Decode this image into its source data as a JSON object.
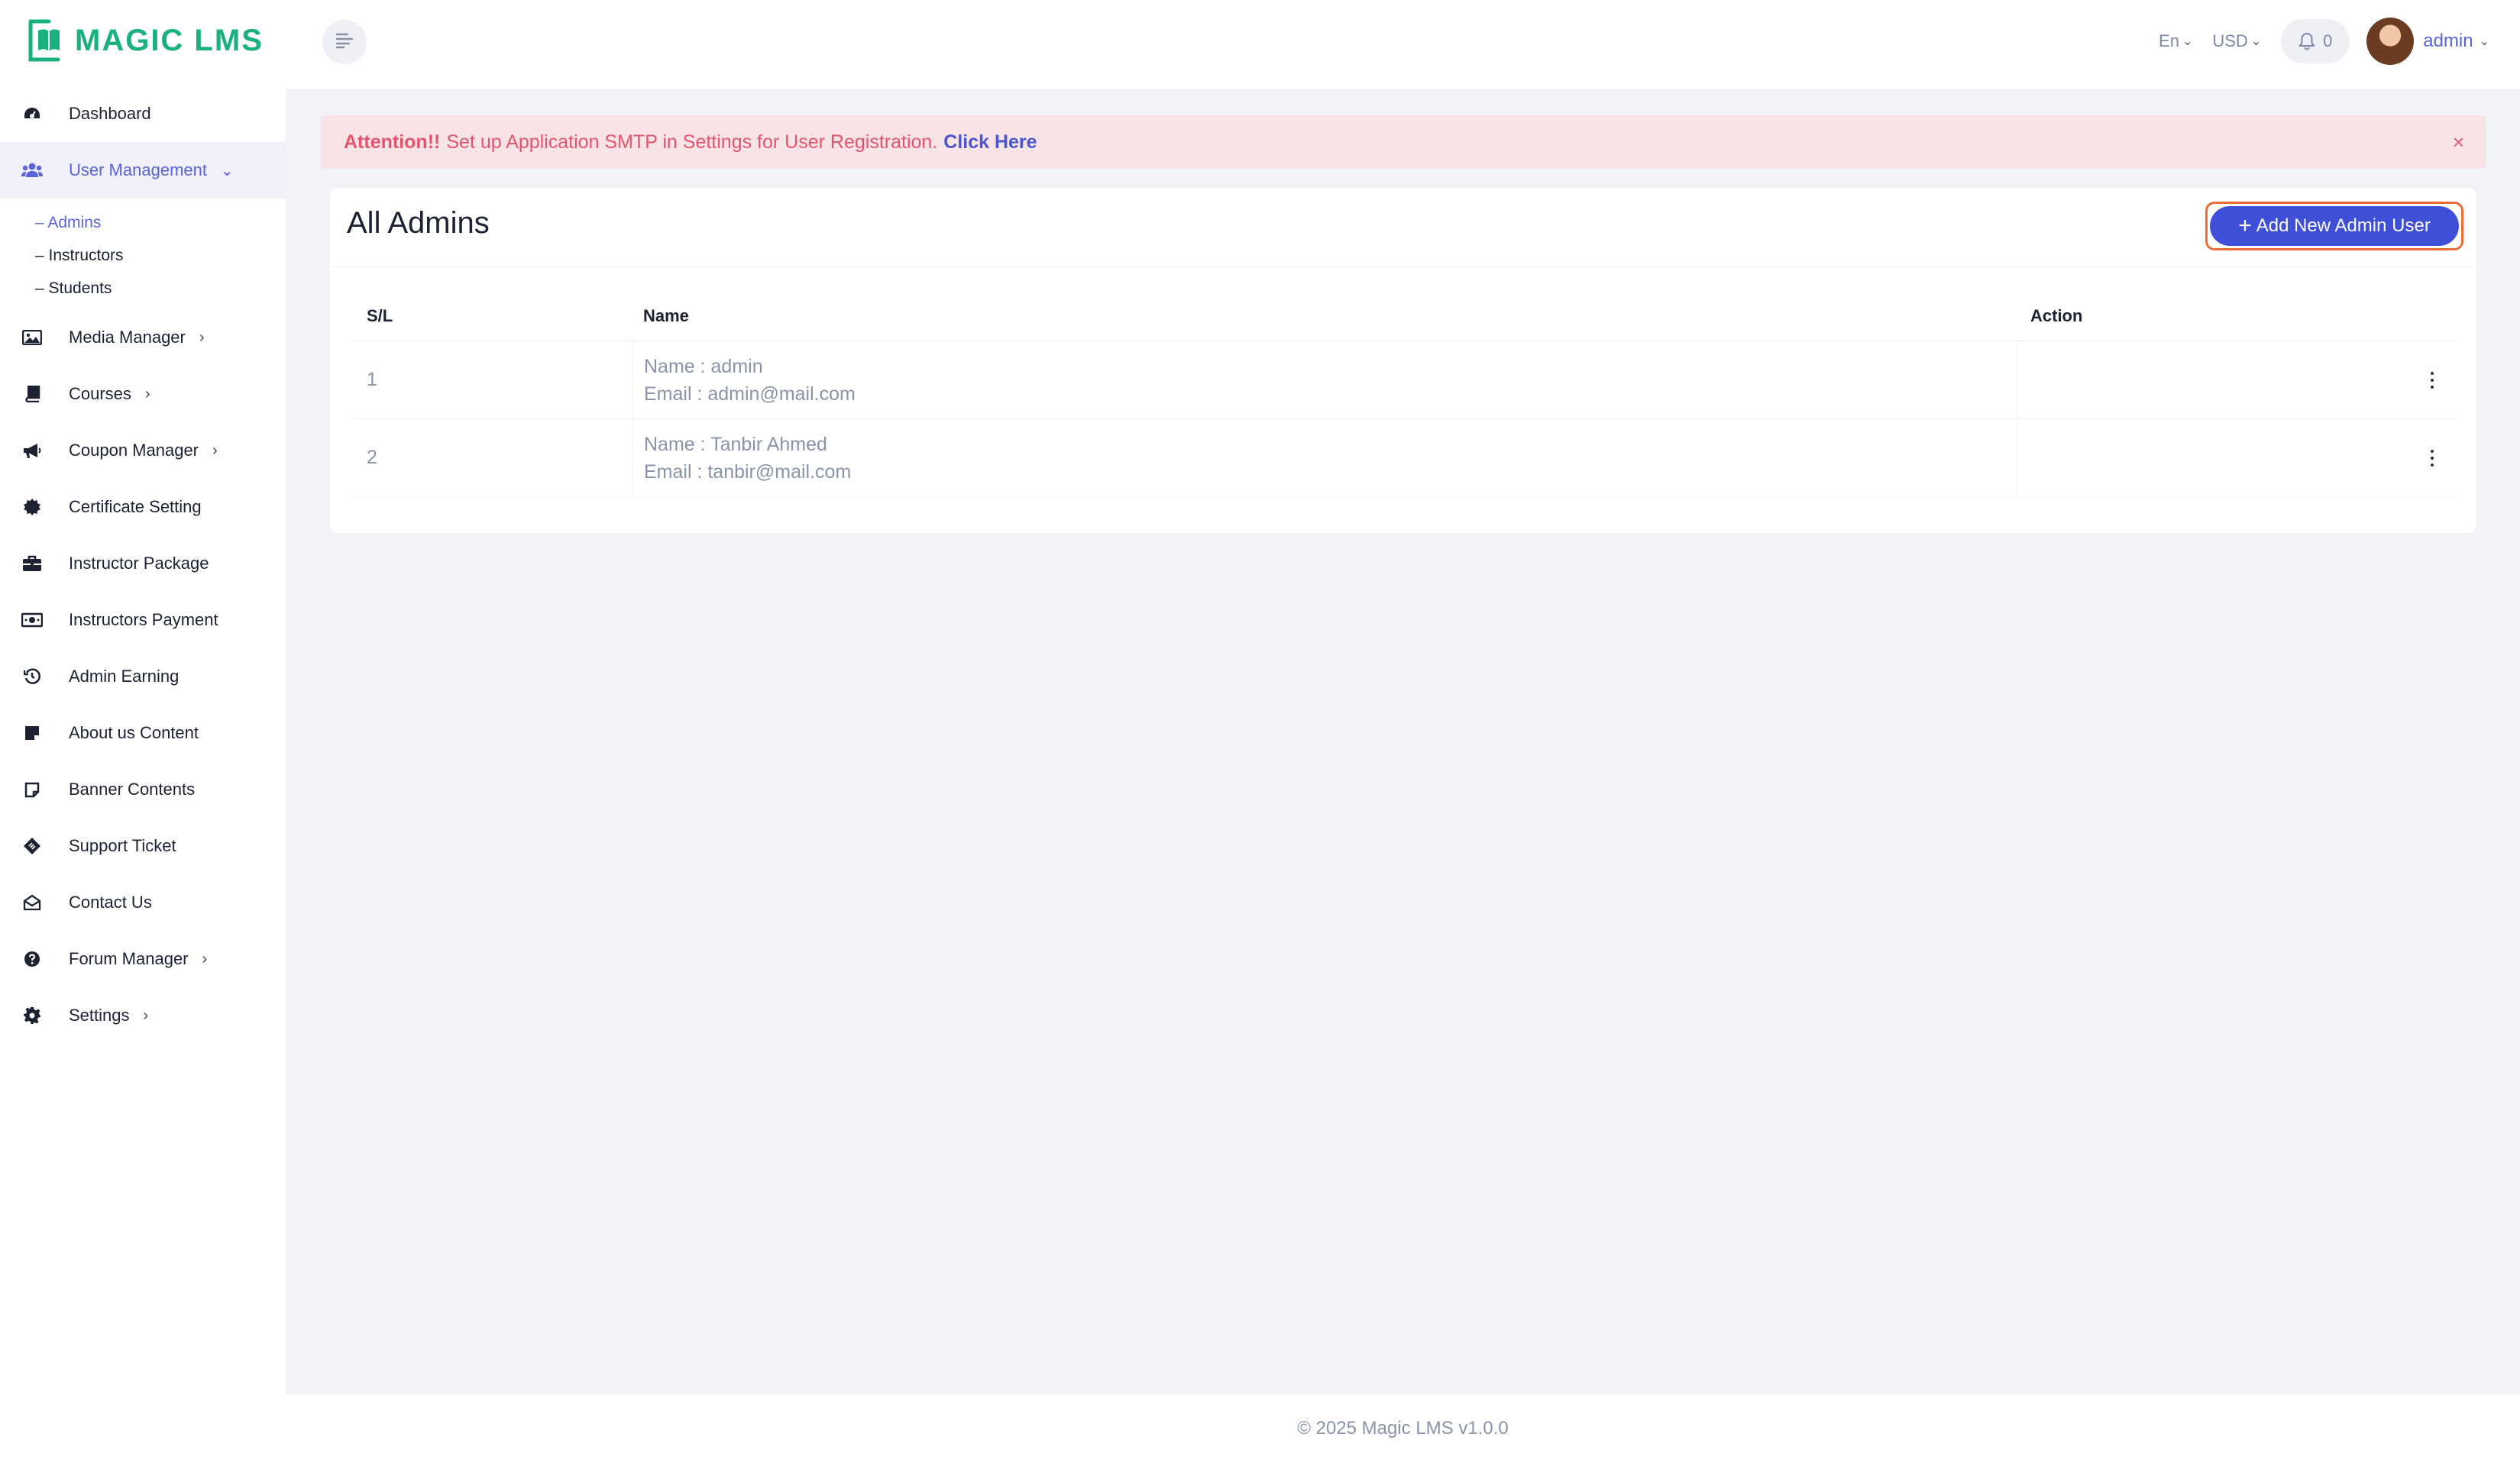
{
  "brand": {
    "name": "MAGIC LMS",
    "color": "#1bb17f"
  },
  "sidebar": {
    "items": [
      {
        "label": "Dashboard",
        "icon": "dashboard-icon"
      },
      {
        "label": "User Management",
        "icon": "users-icon",
        "expanded": true,
        "children": [
          "– Admins",
          "– Instructors",
          "– Students"
        ],
        "active_child": "– Admins"
      },
      {
        "label": "Media Manager",
        "icon": "image-icon"
      },
      {
        "label": "Courses",
        "icon": "book-icon"
      },
      {
        "label": "Coupon Manager",
        "icon": "megaphone-icon"
      },
      {
        "label": "Certificate Setting",
        "icon": "certificate-icon"
      },
      {
        "label": "Instructor Package",
        "icon": "briefcase-icon"
      },
      {
        "label": "Instructors Payment",
        "icon": "money-icon"
      },
      {
        "label": "Admin Earning",
        "icon": "history-icon"
      },
      {
        "label": "About us Content",
        "icon": "note-icon"
      },
      {
        "label": "Banner Contents",
        "icon": "sticky-note-icon"
      },
      {
        "label": "Support Ticket",
        "icon": "ticket-icon"
      },
      {
        "label": "Contact Us",
        "icon": "envelope-open-icon"
      },
      {
        "label": "Forum Manager",
        "icon": "question-circle-icon"
      },
      {
        "label": "Settings",
        "icon": "gear-icon"
      }
    ]
  },
  "header": {
    "language": "En",
    "currency": "USD",
    "notification_count": "0",
    "user": "admin"
  },
  "alert": {
    "prefix": "Attention!!",
    "message": "Set up Application SMTP in Settings for User Registration.",
    "link": "Click Here",
    "close": "×"
  },
  "page": {
    "title": "All Admins",
    "add_button": "Add New Admin User"
  },
  "table": {
    "columns": [
      "S/L",
      "Name",
      "Action"
    ],
    "rows": [
      {
        "sl": "1",
        "name": "Name : admin",
        "email": "Email : admin@mail.com"
      },
      {
        "sl": "2",
        "name": "Name : Tanbir Ahmed",
        "email": "Email : tanbir@mail.com"
      }
    ]
  },
  "footer": {
    "text": "© 2025 Magic LMS v1.0.0"
  },
  "colors": {
    "accent": "#3f4fd8",
    "active": "#5a64d6",
    "alert_bg": "#f8e3e7",
    "alert_text": "#e4556d"
  }
}
